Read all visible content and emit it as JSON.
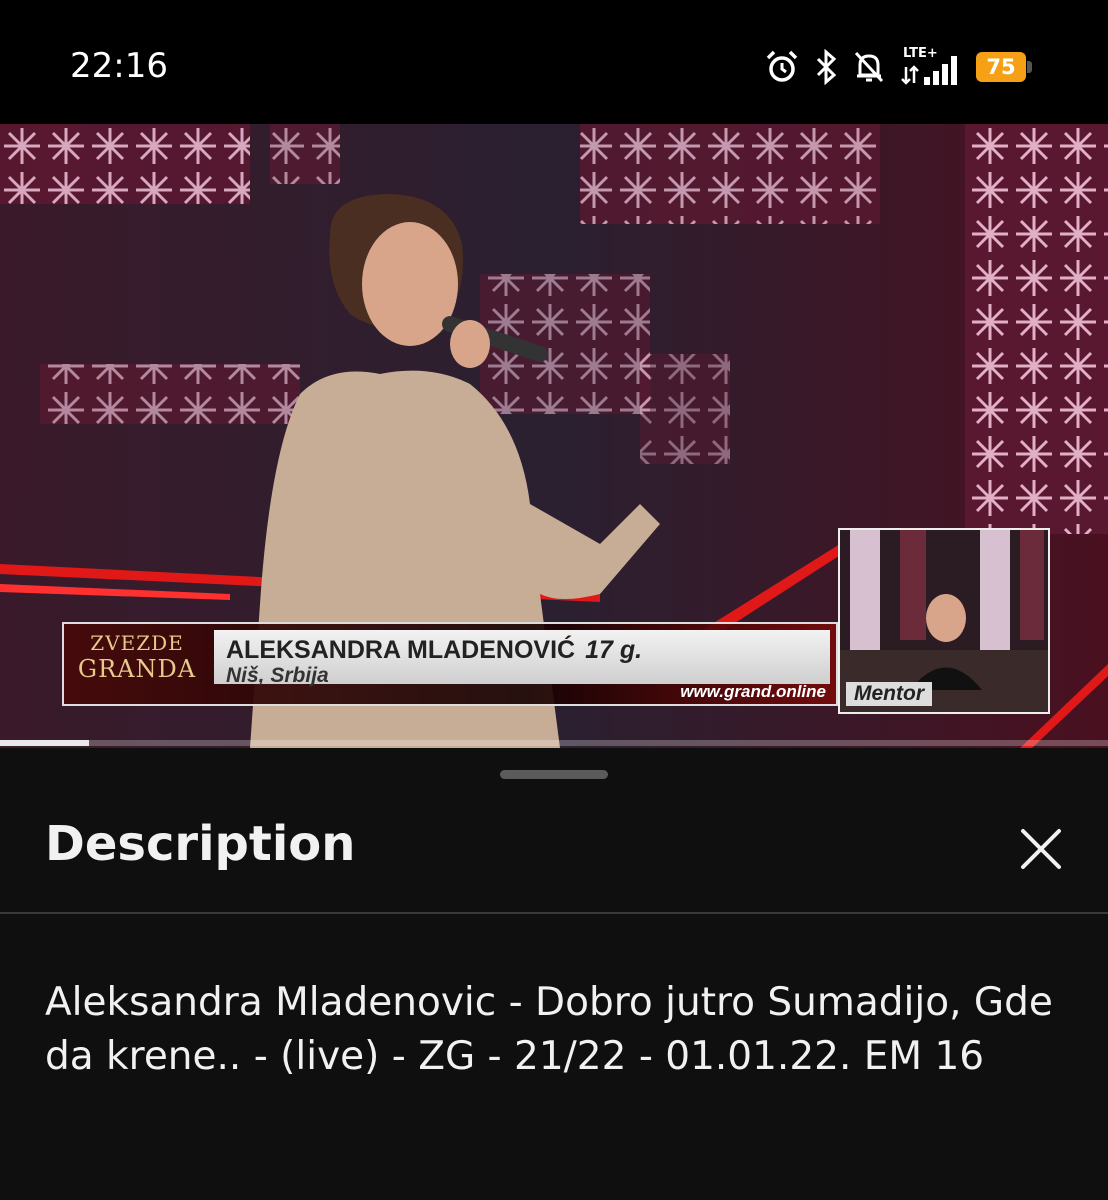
{
  "status_bar": {
    "time": "22:16",
    "icons": [
      "alarm-icon",
      "bluetooth-icon",
      "mute-icon",
      "lte-signal-icon"
    ],
    "network_label": "LTE+",
    "battery_level": "75",
    "battery_color": "#f5a015"
  },
  "video": {
    "progress": 0.08,
    "overlay": {
      "logo_line1": "ZVEZDE",
      "logo_line2": "GRANDA",
      "name": "ALEKSANDRA MLADENOVIĆ",
      "age": "17 g.",
      "city": "Niš, Srbija",
      "website": "www.grand.online"
    },
    "pip_label": "Mentor"
  },
  "sheet": {
    "title": "Description",
    "close_icon": "close-icon",
    "description": "Aleksandra Mladenovic - Dobro jutro Sumadijo, Gde da krene.. - (live) - ZG - 21/22 - 01.01.22. EM 16"
  }
}
